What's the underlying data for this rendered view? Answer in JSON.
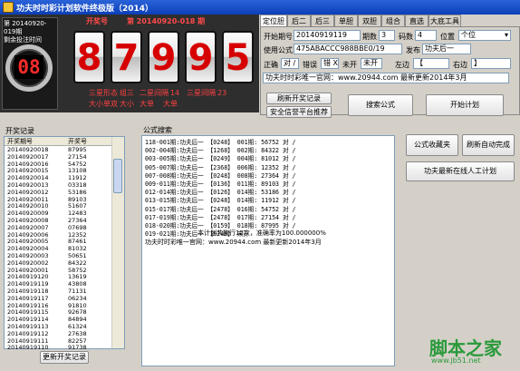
{
  "window": {
    "title": "功夫时时彩计划软件终极版（2014）"
  },
  "clock": {
    "line1": "第 20140920-019期",
    "line2": "剩余投注时间",
    "seconds": "08"
  },
  "draw": {
    "label": "开奖号",
    "number_text": "第 20140920-018 期",
    "digits": [
      "8",
      "7",
      "9",
      "9",
      "5"
    ]
  },
  "stats": {
    "row1": [
      "三星形态",
      "组三",
      "二星间隔",
      "14",
      "三星间隔",
      "23"
    ],
    "row2": [
      "大小单双",
      "大小",
      "大单",
      "大单"
    ]
  },
  "tabs": [
    "定位胆",
    "后二",
    "后三",
    "单胆",
    "双胆",
    "组合",
    "直选",
    "大底工具"
  ],
  "form": {
    "issue_label": "开始期号",
    "issue_value": "20140919119",
    "periods_label": "期数",
    "periods_value": "3",
    "code_label": "码数",
    "code_value": "4",
    "pos_label": "位置",
    "pos_value": "个位",
    "formula_label": "使用公式",
    "formula_value": "475ABACCC988BBE0/19",
    "author_label": "发布",
    "author_value": "功夫后一",
    "correct_label": "正确",
    "correct_value": "对 /",
    "wrong_label": "错误",
    "wrong_value": "错 X",
    "miss_label": "未开",
    "miss_value": "未开",
    "left_label": "左边",
    "left_value": "【",
    "right_label": "右边",
    "right_value": "】",
    "ad_text": "功夫时时彩唯一官网：www.20944.com 最新更新2014年3月"
  },
  "buttons": {
    "analyze": "刷新开奖记录",
    "security": "安全信誉平台推荐",
    "search": "搜索公式",
    "plan": "开始计划",
    "favorites": "公式收藏夹",
    "auto_refresh": "刷新自动完成",
    "manual": "功夫最新在线人工计划",
    "refresh_records": "更新开奖记录"
  },
  "records": {
    "label": "开奖记录",
    "headers": [
      "开奖期号",
      "开奖号"
    ],
    "rows": [
      [
        "20140920018",
        "87995"
      ],
      [
        "20140920017",
        "27154"
      ],
      [
        "20140920016",
        "54752"
      ],
      [
        "20140920015",
        "13108"
      ],
      [
        "20140920014",
        "11912"
      ],
      [
        "20140920013",
        "03318"
      ],
      [
        "20140920012",
        "53186"
      ],
      [
        "20140920011",
        "89103"
      ],
      [
        "20140920010",
        "51607"
      ],
      [
        "20140920009",
        "12483"
      ],
      [
        "20140920008",
        "27364"
      ],
      [
        "20140920007",
        "07698"
      ],
      [
        "20140920006",
        "12352"
      ],
      [
        "20140920005",
        "87461"
      ],
      [
        "20140920004",
        "81032"
      ],
      [
        "20140920003",
        "50651"
      ],
      [
        "20140920002",
        "84322"
      ],
      [
        "20140920001",
        "58752"
      ],
      [
        "20140919120",
        "13619"
      ],
      [
        "20140919119",
        "43808"
      ],
      [
        "20140919118",
        "71131"
      ],
      [
        "20140919117",
        "06234"
      ],
      [
        "20140919116",
        "91810"
      ],
      [
        "20140919115",
        "92678"
      ],
      [
        "20140919114",
        "84894"
      ],
      [
        "20140919113",
        "61324"
      ],
      [
        "20140919112",
        "27638"
      ],
      [
        "20140919111",
        "82257"
      ],
      [
        "20140919110",
        "91738"
      ]
    ]
  },
  "formula": {
    "label": "公式搜索",
    "lines": [
      "118-001期:功夫后一 【0248】 001期: 56752 对 /",
      "002-004期:功夫后一 【1268】 002期: 84322 对 /",
      "003-005期:功夫后一 【0249】 004期: 81012 对 /",
      "005-007期:功夫后一 【2368】 006期: 12352 对 /",
      "007-008期:功夫后一 【0248】 008期: 27364 对 /",
      "009-011期:功夫后一 【0136】 011期: 89103 对 /",
      "012-014期:功夫后一 【0126】 014期: 53186 对 /",
      "013-015期:功夫后一 【0248】 014期: 11912 对 /",
      "015-017期:功夫后一 【2478】 016期: 54752 对 /",
      "017-019期:功夫后一 【2478】 017期: 27154 对 /",
      "018-020期:功夫后一 【0159】 018期: 87995 对 /",
      "019-021期:功夫后一 【0248】 未开"
    ],
    "summary": "本计划共执行12次，准确率为100.000000%",
    "site": "功夫时时彩唯一官网：www.20944.com 最新更新2014年3月"
  },
  "watermark": {
    "text": "脚本之家",
    "url": "www.jb51.net"
  }
}
